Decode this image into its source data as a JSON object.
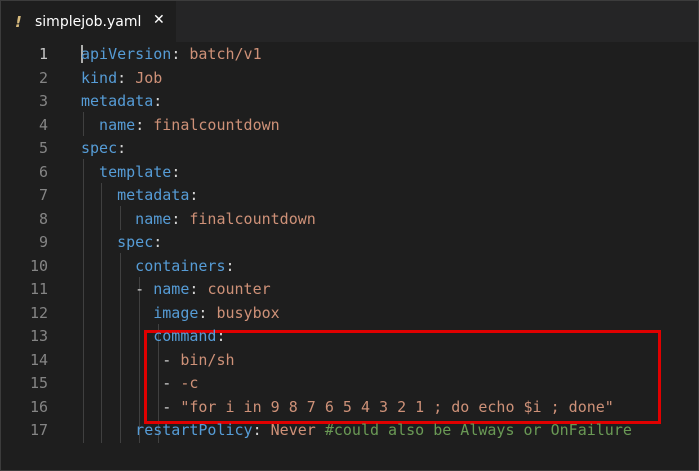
{
  "tab": {
    "icon": "!",
    "icon_name": "yaml-file-icon",
    "label": "simplejob.yaml",
    "close": "✕"
  },
  "colors": {
    "key": "#569cd6",
    "string": "#ce9178",
    "comment": "#6a9955",
    "punctuation": "#d4d4d4",
    "highlight_box": "#e00000"
  },
  "lines": [
    {
      "num": "1",
      "tokens": [
        {
          "t": "apiVersion",
          "c": "k"
        },
        {
          "t": ": ",
          "c": "p"
        },
        {
          "t": "batch/v1",
          "c": "s"
        }
      ]
    },
    {
      "num": "2",
      "tokens": [
        {
          "t": "kind",
          "c": "k"
        },
        {
          "t": ": ",
          "c": "p"
        },
        {
          "t": "Job",
          "c": "s"
        }
      ]
    },
    {
      "num": "3",
      "tokens": [
        {
          "t": "metadata",
          "c": "k"
        },
        {
          "t": ":",
          "c": "p"
        }
      ]
    },
    {
      "num": "4",
      "tokens": [
        {
          "t": "  name",
          "c": "k"
        },
        {
          "t": ": ",
          "c": "p"
        },
        {
          "t": "finalcountdown",
          "c": "s"
        }
      ]
    },
    {
      "num": "5",
      "tokens": [
        {
          "t": "spec",
          "c": "k"
        },
        {
          "t": ":",
          "c": "p"
        }
      ]
    },
    {
      "num": "6",
      "tokens": [
        {
          "t": "  template",
          "c": "k"
        },
        {
          "t": ":",
          "c": "p"
        }
      ]
    },
    {
      "num": "7",
      "tokens": [
        {
          "t": "    metadata",
          "c": "k"
        },
        {
          "t": ":",
          "c": "p"
        }
      ]
    },
    {
      "num": "8",
      "tokens": [
        {
          "t": "      name",
          "c": "k"
        },
        {
          "t": ": ",
          "c": "p"
        },
        {
          "t": "finalcountdown",
          "c": "s"
        }
      ]
    },
    {
      "num": "9",
      "tokens": [
        {
          "t": "    spec",
          "c": "k"
        },
        {
          "t": ":",
          "c": "p"
        }
      ]
    },
    {
      "num": "10",
      "tokens": [
        {
          "t": "      containers",
          "c": "k"
        },
        {
          "t": ":",
          "c": "p"
        }
      ]
    },
    {
      "num": "11",
      "tokens": [
        {
          "t": "      - ",
          "c": "p"
        },
        {
          "t": "name",
          "c": "k"
        },
        {
          "t": ": ",
          "c": "p"
        },
        {
          "t": "counter",
          "c": "s"
        }
      ]
    },
    {
      "num": "12",
      "tokens": [
        {
          "t": "        image",
          "c": "k"
        },
        {
          "t": ": ",
          "c": "p"
        },
        {
          "t": "busybox",
          "c": "s"
        }
      ]
    },
    {
      "num": "13",
      "tokens": [
        {
          "t": "        command",
          "c": "k"
        },
        {
          "t": ":",
          "c": "p"
        }
      ]
    },
    {
      "num": "14",
      "tokens": [
        {
          "t": "         - ",
          "c": "p"
        },
        {
          "t": "bin/sh",
          "c": "s"
        }
      ]
    },
    {
      "num": "15",
      "tokens": [
        {
          "t": "         - ",
          "c": "p"
        },
        {
          "t": "-c",
          "c": "s"
        }
      ]
    },
    {
      "num": "16",
      "tokens": [
        {
          "t": "         - ",
          "c": "p"
        },
        {
          "t": "\"for i in 9 8 7 6 5 4 3 2 1 ; do echo $i ; done\"",
          "c": "s"
        }
      ]
    },
    {
      "num": "17",
      "tokens": [
        {
          "t": "      restartPolicy",
          "c": "k"
        },
        {
          "t": ": ",
          "c": "p"
        },
        {
          "t": "Never ",
          "c": "s"
        },
        {
          "t": "#could also be Always or OnFailure",
          "c": "c"
        }
      ]
    }
  ]
}
